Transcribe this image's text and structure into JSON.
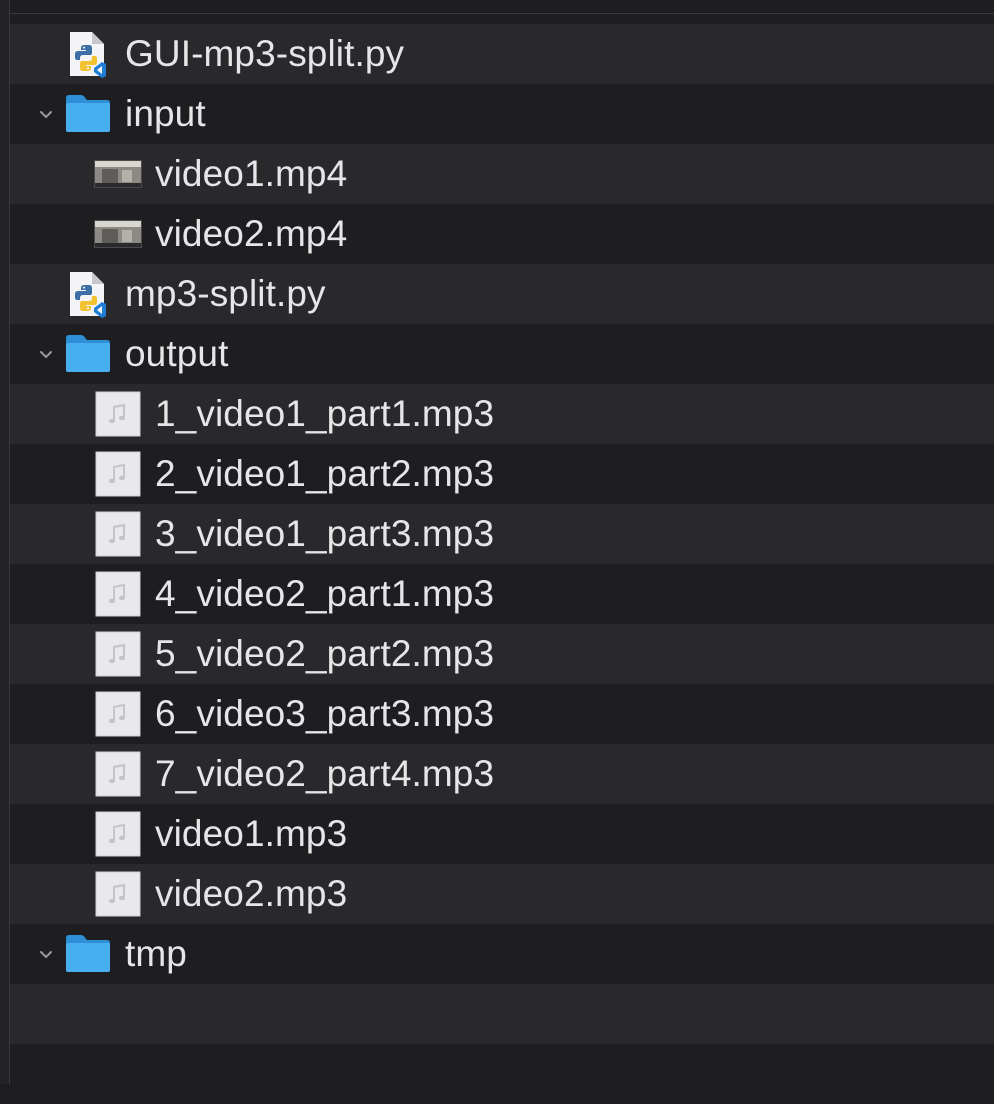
{
  "files": [
    {
      "name": "GUI-mp3-split.py",
      "type": "python",
      "icon": "python-file-icon",
      "level": 0
    },
    {
      "name": "input",
      "type": "folder",
      "icon": "folder-icon",
      "level": 0,
      "expanded": true
    },
    {
      "name": "video1.mp4",
      "type": "video",
      "icon": "video-thumbnail-icon",
      "level": 1
    },
    {
      "name": "video2.mp4",
      "type": "video",
      "icon": "video-thumbnail-icon",
      "level": 1
    },
    {
      "name": "mp3-split.py",
      "type": "python",
      "icon": "python-file-icon",
      "level": 0
    },
    {
      "name": "output",
      "type": "folder",
      "icon": "folder-icon",
      "level": 0,
      "expanded": true
    },
    {
      "name": "1_video1_part1.mp3",
      "type": "audio",
      "icon": "audio-file-icon",
      "level": 1
    },
    {
      "name": "2_video1_part2.mp3",
      "type": "audio",
      "icon": "audio-file-icon",
      "level": 1
    },
    {
      "name": "3_video1_part3.mp3",
      "type": "audio",
      "icon": "audio-file-icon",
      "level": 1
    },
    {
      "name": "4_video2_part1.mp3",
      "type": "audio",
      "icon": "audio-file-icon",
      "level": 1
    },
    {
      "name": "5_video2_part2.mp3",
      "type": "audio",
      "icon": "audio-file-icon",
      "level": 1
    },
    {
      "name": "6_video3_part3.mp3",
      "type": "audio",
      "icon": "audio-file-icon",
      "level": 1
    },
    {
      "name": "7_video2_part4.mp3",
      "type": "audio",
      "icon": "audio-file-icon",
      "level": 1
    },
    {
      "name": "video1.mp3",
      "type": "audio",
      "icon": "audio-file-icon",
      "level": 1
    },
    {
      "name": "video2.mp3",
      "type": "audio",
      "icon": "audio-file-icon",
      "level": 1
    },
    {
      "name": "tmp",
      "type": "folder",
      "icon": "folder-icon",
      "level": 0,
      "expanded": true
    }
  ],
  "colors": {
    "background": "#1e1e20",
    "alt_row": "#29292b",
    "text": "#e6e6e8",
    "folder_blue": "#3ea3e8"
  }
}
